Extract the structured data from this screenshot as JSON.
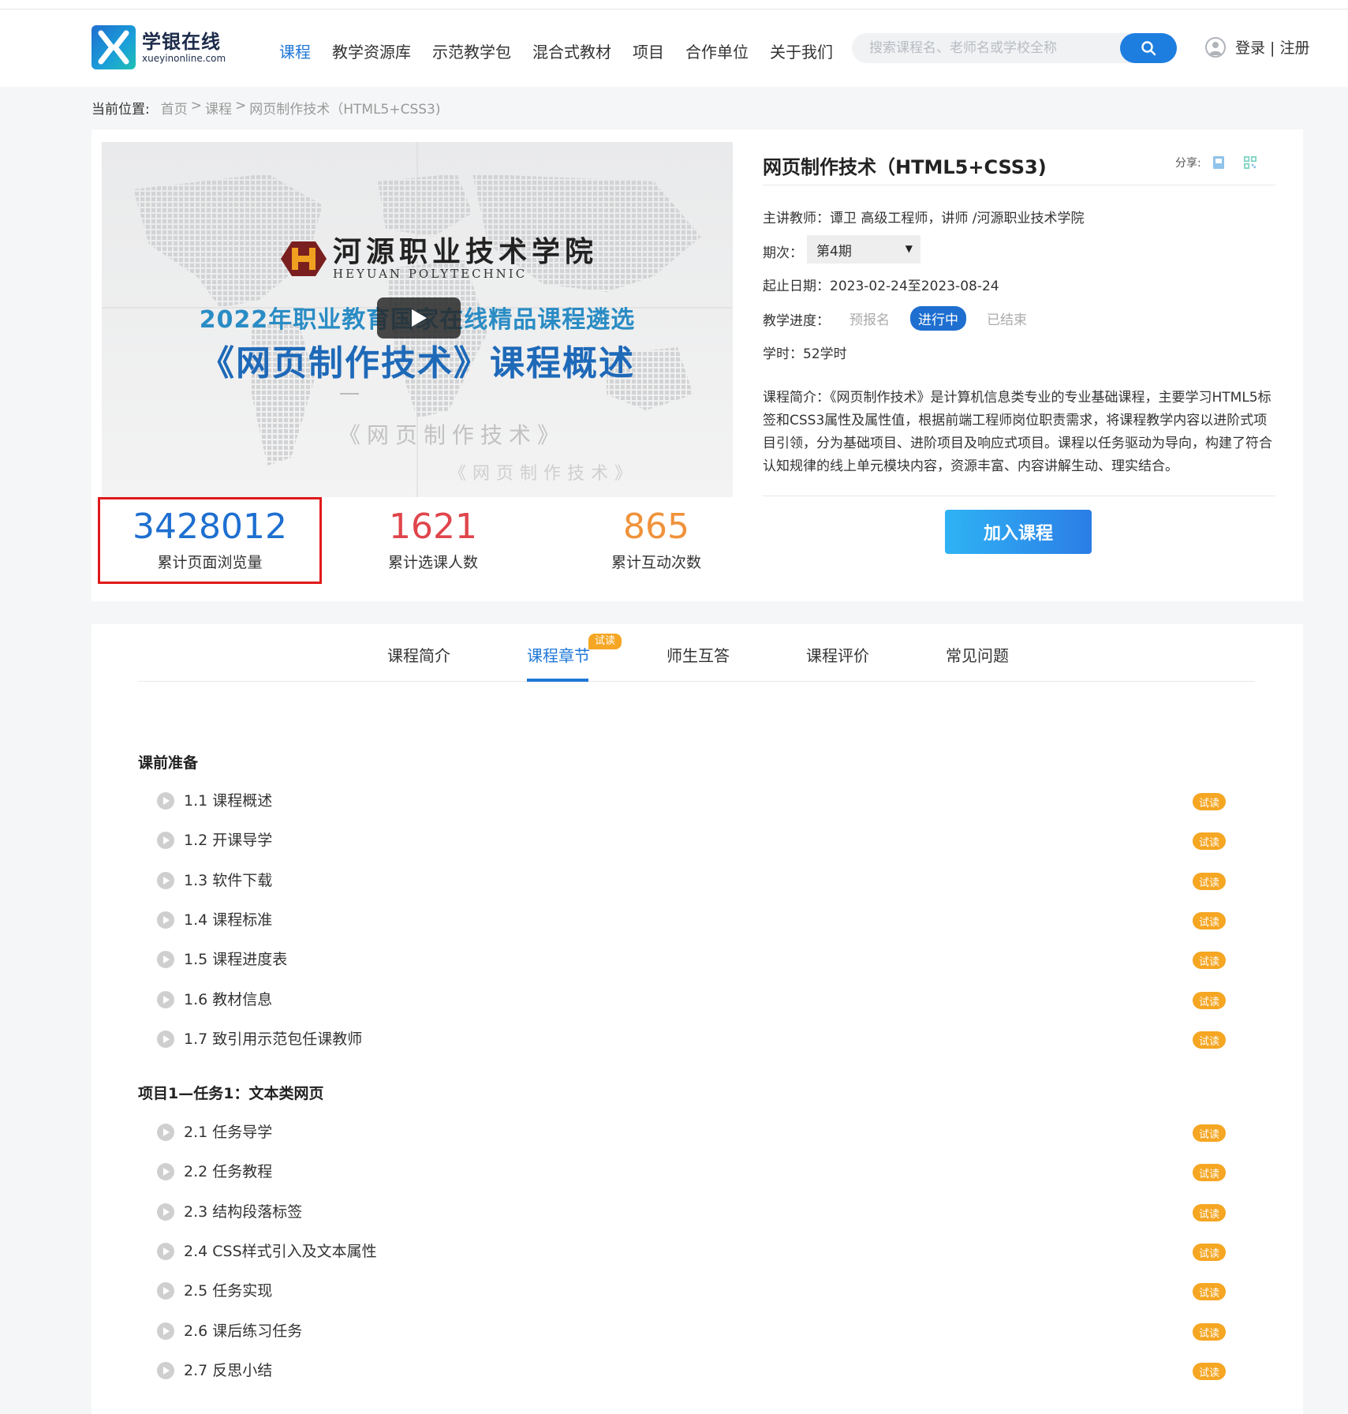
{
  "header": {
    "logo_cn": "学银在线",
    "logo_en": "xueyinonline.com",
    "nav": [
      "课程",
      "教学资源库",
      "示范教学包",
      "混合式教材",
      "项目",
      "合作单位",
      "关于我们"
    ],
    "active_nav": 0,
    "search_placeholder": "搜索课程名、老师名或学校全称",
    "login": "登录 | 注册"
  },
  "breadcrumb": {
    "label": "当前位置:",
    "home": "首页",
    "sep1": ">",
    "courses": "课程",
    "sep2": ">",
    "current": "网页制作技术（HTML5+CSS3)"
  },
  "cover": {
    "school_cn": "河源职业技术学院",
    "school_en": "HEYUAN POLYTECHNIC",
    "line1": "2022年职业教育国家在线精品课程遴选",
    "line2": "《网页制作技术》课程概述",
    "line3": "《网页制作技术》",
    "line4": "《网页制作技术》"
  },
  "course": {
    "title": "网页制作技术（HTML5+CSS3)",
    "share_label": "分享:",
    "teacher": "主讲教师：谭卫 高级工程师，讲师 /河源职业技术学院",
    "term_label": "期次：",
    "term_value": "第4期",
    "dates": "起止日期：2023-02-24至2023-08-24",
    "progress_label": "教学进度：",
    "progress_steps": [
      "预报名",
      "进行中",
      "已结束"
    ],
    "progress_active": 1,
    "hours": "学时：52学时",
    "description": "课程简介：《网页制作技术》是计算机信息类专业的专业基础课程，主要学习HTML5标签和CSS3属性及属性值，根据前端工程师岗位职责需求，将课程教学内容以进阶式项目引领，分为基础项目、进阶项目及响应式项目。课程以任务驱动为导向，构建了符合认知规律的线上单元模块内容，资源丰富、内容讲解生动、理实结合。"
  },
  "stats": [
    {
      "value": "3428012",
      "label": "累计页面浏览量",
      "color": "#1e6fd0"
    },
    {
      "value": "1621",
      "label": "累计选课人数",
      "color": "#e0454c"
    },
    {
      "value": "865",
      "label": "累计互动次数",
      "color": "#f0923a"
    }
  ],
  "join_button": "加入课程",
  "tabs": [
    {
      "label": "课程简介"
    },
    {
      "label": "课程章节",
      "badge": "试读"
    },
    {
      "label": "师生互答"
    },
    {
      "label": "课程评价"
    },
    {
      "label": "常见问题"
    }
  ],
  "active_tab": 1,
  "sections": [
    {
      "title": "课前准备",
      "lessons": [
        "1.1 课程概述",
        "1.2 开课导学",
        "1.3 软件下载",
        "1.4 课程标准",
        "1.5 课程进度表",
        "1.6 教材信息",
        "1.7 致引用示范包任课教师"
      ]
    },
    {
      "title": "项目1—任务1：文本类网页",
      "lessons": [
        "2.1 任务导学",
        "2.2 任务教程",
        "2.3 结构段落标签",
        "2.4 CSS样式引入及文本属性",
        "2.5 任务实现",
        "2.6 课后练习任务",
        "2.7 反思小结"
      ]
    }
  ],
  "lesson_badge": "试读",
  "colors": {
    "accent": "#1f77d8",
    "badge": "#f5a623",
    "highlight_border": "#e01a1a"
  }
}
